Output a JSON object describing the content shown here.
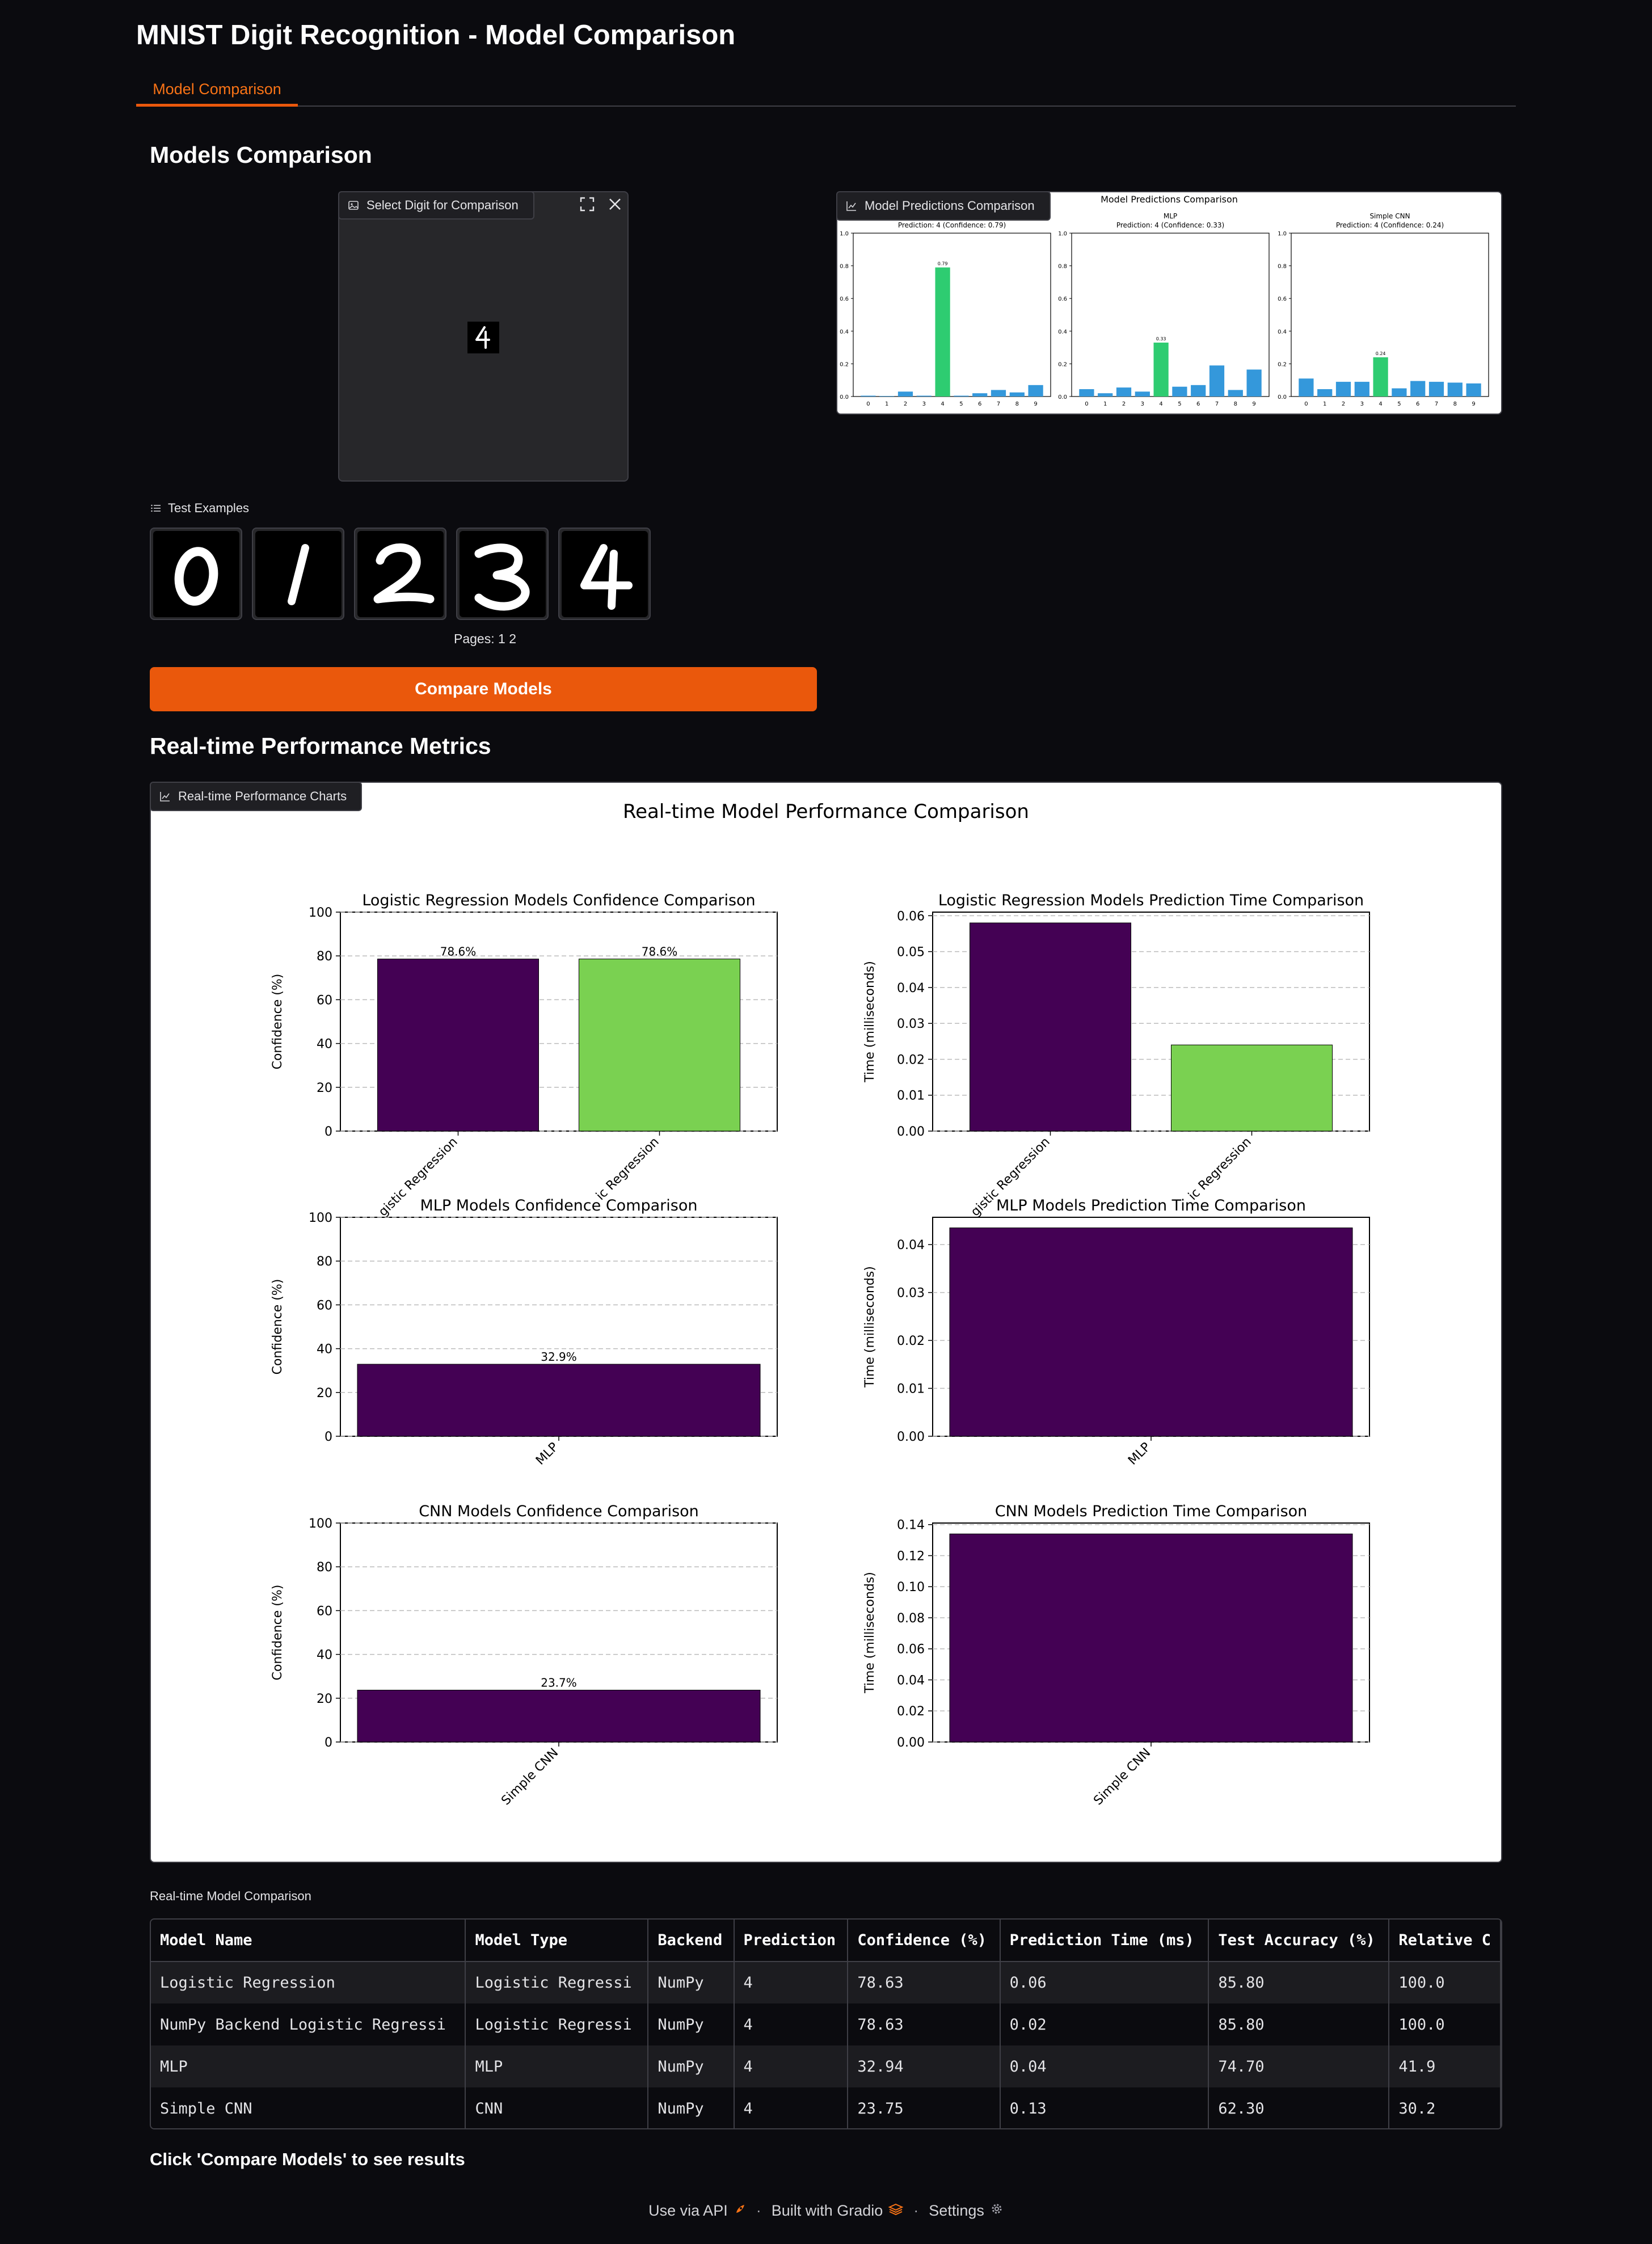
{
  "app": {
    "title": "MNIST Digit Recognition - Model Comparison"
  },
  "tabs": [
    {
      "label": "Model Comparison",
      "active": true
    }
  ],
  "sections": {
    "models_comparison": "Models Comparison",
    "realtime_metrics": "Real-time Performance Metrics"
  },
  "digit_input": {
    "label": "Select Digit for Comparison",
    "icon": "image-icon",
    "selected_digit": "4"
  },
  "predictions_plot": {
    "label": "Model Predictions Comparison",
    "icon": "chart-icon"
  },
  "examples": {
    "label": "Test Examples",
    "icon": "list-icon",
    "items": [
      "0",
      "1",
      "2",
      "3",
      "4"
    ],
    "pages_label": "Pages:",
    "pages": [
      "1",
      "2"
    ]
  },
  "compare_button": {
    "label": "Compare Models"
  },
  "performance_plot": {
    "label": "Real-time Performance Charts",
    "icon": "chart-icon"
  },
  "table": {
    "caption": "Real-time Model Comparison",
    "headers": [
      "Model Name",
      "Model Type",
      "Backend",
      "Prediction",
      "Confidence (%)",
      "Prediction Time (ms)",
      "Test Accuracy (%)",
      "Relative C"
    ],
    "rows": [
      [
        "Logistic Regression",
        "Logistic Regressi",
        "NumPy",
        "4",
        "78.63",
        "0.06",
        "85.80",
        "100.0"
      ],
      [
        "NumPy Backend Logistic Regressi",
        "Logistic Regressi",
        "NumPy",
        "4",
        "78.63",
        "0.02",
        "85.80",
        "100.0"
      ],
      [
        "MLP",
        "MLP",
        "NumPy",
        "4",
        "32.94",
        "0.04",
        "74.70",
        "41.9"
      ],
      [
        "Simple CNN",
        "CNN",
        "NumPy",
        "4",
        "23.75",
        "0.13",
        "62.30",
        "30.2"
      ]
    ]
  },
  "result_note": "Click 'Compare Models' to see results",
  "footer": {
    "api_label": "Use via API",
    "built_label": "Built with Gradio",
    "settings_label": "Settings",
    "separator": "·"
  },
  "colors": {
    "accent": "#ea580c",
    "accent_text": "#f97316",
    "bar_blue": "#3498db",
    "bar_green": "#2ecc71",
    "bar_purple": "#440154",
    "bar_lightgreen": "#7ad151"
  },
  "chart_data": [
    {
      "type": "bar",
      "title": "Model Predictions Comparison",
      "panels": [
        {
          "title": "",
          "subtitle": "Prediction: 4 (Confidence: 0.79)",
          "categories": [
            "0",
            "1",
            "2",
            "3",
            "4",
            "5",
            "6",
            "7",
            "8",
            "9"
          ],
          "values": [
            0.005,
            0.003,
            0.03,
            0.005,
            0.79,
            0.005,
            0.02,
            0.04,
            0.025,
            0.07
          ],
          "highlight_index": 4,
          "highlight_label": "0.79",
          "ylim": [
            0,
            1.0
          ],
          "yticks": [
            "0.0",
            "0.2",
            "0.4",
            "0.6",
            "0.8",
            "1.0"
          ]
        },
        {
          "title": "MLP",
          "subtitle": "Prediction: 4 (Confidence: 0.33)",
          "categories": [
            "0",
            "1",
            "2",
            "3",
            "4",
            "5",
            "6",
            "7",
            "8",
            "9"
          ],
          "values": [
            0.045,
            0.02,
            0.055,
            0.03,
            0.33,
            0.06,
            0.07,
            0.19,
            0.04,
            0.165
          ],
          "highlight_index": 4,
          "highlight_label": "0.33",
          "ylim": [
            0,
            1.0
          ],
          "yticks": [
            "0.0",
            "0.2",
            "0.4",
            "0.6",
            "0.8",
            "1.0"
          ]
        },
        {
          "title": "Simple CNN",
          "subtitle": "Prediction: 4 (Confidence: 0.24)",
          "categories": [
            "0",
            "1",
            "2",
            "3",
            "4",
            "5",
            "6",
            "7",
            "8",
            "9"
          ],
          "values": [
            0.11,
            0.045,
            0.09,
            0.09,
            0.24,
            0.05,
            0.095,
            0.09,
            0.085,
            0.08
          ],
          "highlight_index": 4,
          "highlight_label": "0.24",
          "ylim": [
            0,
            1.0
          ],
          "yticks": [
            "0.0",
            "0.2",
            "0.4",
            "0.6",
            "0.8",
            "1.0"
          ]
        }
      ]
    },
    {
      "type": "bar",
      "title": "Real-time Model Performance Comparison",
      "panels": [
        {
          "title": "Logistic Regression Models Confidence Comparison",
          "ylabel": "Confidence (%)",
          "categories": [
            "Logistic Regression",
            "NumPy Backend Logistic Regression"
          ],
          "cat_display": [
            "gistic Regression",
            "ic Regression"
          ],
          "values": [
            78.6,
            78.6
          ],
          "value_labels": [
            "78.6%",
            "78.6%"
          ],
          "colors": [
            "#440154",
            "#7ad151"
          ],
          "ylim": [
            0,
            100
          ],
          "yticks": [
            "0",
            "20",
            "40",
            "60",
            "80",
            "100"
          ]
        },
        {
          "title": "Logistic Regression Models Prediction Time Comparison",
          "ylabel": "Time (milliseconds)",
          "categories": [
            "Logistic Regression",
            "NumPy Backend Logistic Regression"
          ],
          "cat_display": [
            "gistic Regression",
            "ic Regression"
          ],
          "values": [
            0.058,
            0.024
          ],
          "value_labels": [],
          "colors": [
            "#440154",
            "#7ad151"
          ],
          "ylim": [
            0,
            0.061
          ],
          "yticks": [
            "0.00",
            "0.01",
            "0.02",
            "0.03",
            "0.04",
            "0.05",
            "0.06"
          ]
        },
        {
          "title": "MLP Models Confidence Comparison",
          "ylabel": "Confidence (%)",
          "categories": [
            "MLP"
          ],
          "cat_display": [
            "MLP"
          ],
          "values": [
            32.9
          ],
          "value_labels": [
            "32.9%"
          ],
          "colors": [
            "#440154"
          ],
          "ylim": [
            0,
            100
          ],
          "yticks": [
            "0",
            "20",
            "40",
            "60",
            "80",
            "100"
          ]
        },
        {
          "title": "MLP Models Prediction Time Comparison",
          "ylabel": "Time (milliseconds)",
          "categories": [
            "MLP"
          ],
          "cat_display": [
            "MLP"
          ],
          "values": [
            0.0435
          ],
          "value_labels": [],
          "colors": [
            "#440154"
          ],
          "ylim": [
            0,
            0.0457
          ],
          "yticks": [
            "0.00",
            "0.01",
            "0.02",
            "0.03",
            "0.04"
          ]
        },
        {
          "title": "CNN Models Confidence Comparison",
          "ylabel": "Confidence (%)",
          "categories": [
            "Simple CNN"
          ],
          "cat_display": [
            "Simple CNN"
          ],
          "values": [
            23.7
          ],
          "value_labels": [
            "23.7%"
          ],
          "colors": [
            "#440154"
          ],
          "ylim": [
            0,
            100
          ],
          "yticks": [
            "0",
            "20",
            "40",
            "60",
            "80",
            "100"
          ]
        },
        {
          "title": "CNN Models Prediction Time Comparison",
          "ylabel": "Time (milliseconds)",
          "categories": [
            "Simple CNN"
          ],
          "cat_display": [
            "Simple CNN"
          ],
          "values": [
            0.134
          ],
          "value_labels": [],
          "colors": [
            "#440154"
          ],
          "ylim": [
            0,
            0.141
          ],
          "yticks": [
            "0.00",
            "0.02",
            "0.04",
            "0.06",
            "0.08",
            "0.10",
            "0.12",
            "0.14"
          ]
        }
      ]
    }
  ]
}
